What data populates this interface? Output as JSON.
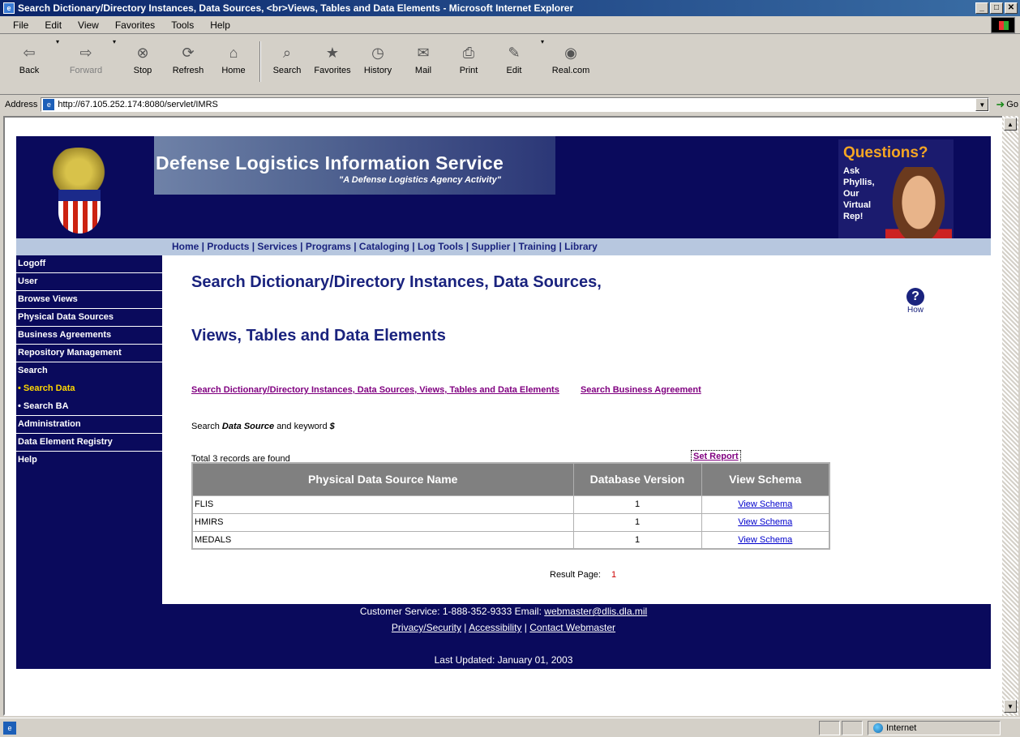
{
  "window": {
    "title": "Search Dictionary/Directory Instances, Data Sources, <br>Views, Tables and Data Elements - Microsoft Internet Explorer",
    "min": "_",
    "max": "□",
    "close": "✕"
  },
  "menu": [
    "File",
    "Edit",
    "View",
    "Favorites",
    "Tools",
    "Help"
  ],
  "toolbar": {
    "back": "Back",
    "forward": "Forward",
    "stop": "Stop",
    "refresh": "Refresh",
    "home": "Home",
    "search": "Search",
    "favorites": "Favorites",
    "history": "History",
    "mail": "Mail",
    "print": "Print",
    "edit": "Edit",
    "realcom": "Real.com"
  },
  "address": {
    "label": "Address",
    "url": "http://67.105.252.174:8080/servlet/IMRS",
    "go": "Go"
  },
  "status": {
    "zone": "Internet"
  },
  "banner": {
    "title": "Defense Logistics Information Service",
    "subtitle": "\"A Defense Logistics Agency Activity\"",
    "questions": "Questions?",
    "ask": [
      "Ask",
      "Phyllis,",
      "Our",
      "Virtual",
      "Rep!"
    ]
  },
  "nav": [
    "Home",
    "Products",
    "Services",
    "Programs",
    "Cataloging",
    "Log Tools",
    "Supplier",
    "Training",
    "Library"
  ],
  "sidebar": [
    {
      "label": "Logoff"
    },
    {
      "label": "User"
    },
    {
      "label": "Browse Views"
    },
    {
      "label": "Physical Data Sources"
    },
    {
      "label": "Business Agreements"
    },
    {
      "label": "Repository Management"
    },
    {
      "label": "Search"
    },
    {
      "label": "• Search Data"
    },
    {
      "label": "• Search BA"
    },
    {
      "label": "Administration"
    },
    {
      "label": "Data Element Registry"
    },
    {
      "label": "Help"
    }
  ],
  "main": {
    "heading_line1": "Search Dictionary/Directory Instances, Data Sources,",
    "heading_line2": "Views, Tables and Data Elements",
    "how_label": "How",
    "link_search_dd": "Search Dictionary/Directory Instances, Data Sources, Views, Tables and Data Elements",
    "link_search_ba": "Search Business Agreement",
    "criteria_prefix": "Search",
    "criteria_field": "Data Source",
    "criteria_mid": "and keyword",
    "criteria_keyword": "$",
    "total": "Total 3 records are found",
    "set_report": "Set Report",
    "columns": [
      "Physical Data Source Name",
      "Database Version",
      "View Schema"
    ],
    "rows": [
      {
        "name": "FLIS",
        "version": "1",
        "link": "View Schema"
      },
      {
        "name": "HMIRS",
        "version": "1",
        "link": "View Schema"
      },
      {
        "name": "MEDALS",
        "version": "1",
        "link": "View Schema"
      }
    ],
    "result_page_label": "Result Page:",
    "result_page_num": "1"
  },
  "footer": {
    "customer_service": "Customer Service: 1-888-352-9333 Email:",
    "email": "webmaster@dlis.dla.mil",
    "privacy": "Privacy/Security",
    "accessibility": "Accessibility",
    "contact": "Contact Webmaster",
    "updated": "Last Updated: January 01, 2003"
  }
}
